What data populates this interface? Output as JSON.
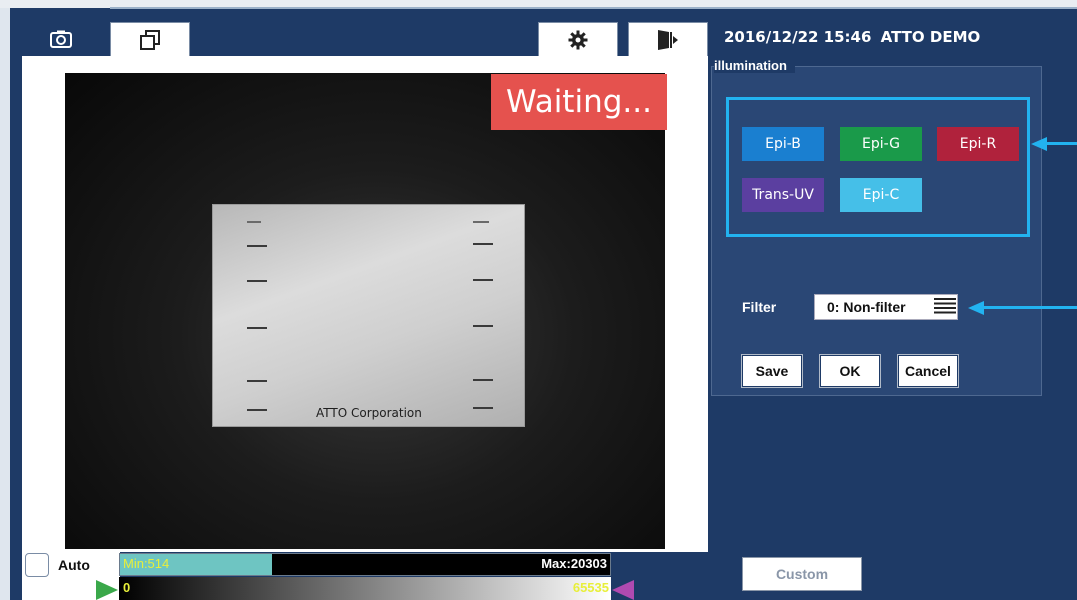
{
  "header": {
    "datetime": "2016/12/22 15:46",
    "device_name": "ATTO DEMO"
  },
  "toolbar": {
    "capture_icon": "camera-icon",
    "windows_icon": "windows-icon",
    "settings_icon": "gear-icon",
    "exit_icon": "exit-icon"
  },
  "viewer": {
    "status": "Waiting...",
    "membrane_label": "ATTO Corporation"
  },
  "histogram": {
    "auto_label": "Auto",
    "auto_checked": false,
    "min_label": "Min:514",
    "max_label": "Max:20303",
    "range_min": "0",
    "range_max": "65535"
  },
  "illumination": {
    "title": "illumination",
    "buttons": [
      {
        "label": "Epi-B",
        "color": "#1a7fd0"
      },
      {
        "label": "Epi-G",
        "color": "#1a9a4a"
      },
      {
        "label": "Epi-R",
        "color": "#b0223c"
      },
      {
        "label": "Trans-UV",
        "color": "#5b3fa0"
      },
      {
        "label": "Epi-C",
        "color": "#45bfe8"
      }
    ]
  },
  "filter": {
    "label": "Filter",
    "value": "0: Non-filter"
  },
  "actions": {
    "save": "Save",
    "ok": "OK",
    "cancel": "Cancel",
    "custom": "Custom"
  },
  "colors": {
    "panel_bg": "#1e3a66",
    "highlight": "#22b3f0",
    "waiting_badge": "#e5524e"
  }
}
